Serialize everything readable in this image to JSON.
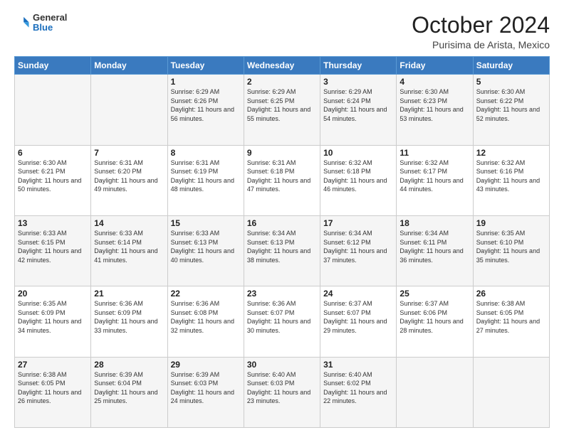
{
  "header": {
    "logo": {
      "general": "General",
      "blue": "Blue"
    },
    "title": "October 2024",
    "location": "Purisima de Arista, Mexico"
  },
  "weekdays": [
    "Sunday",
    "Monday",
    "Tuesday",
    "Wednesday",
    "Thursday",
    "Friday",
    "Saturday"
  ],
  "weeks": [
    [
      {
        "day": "",
        "info": ""
      },
      {
        "day": "",
        "info": ""
      },
      {
        "day": "1",
        "info": "Sunrise: 6:29 AM\nSunset: 6:26 PM\nDaylight: 11 hours and 56 minutes."
      },
      {
        "day": "2",
        "info": "Sunrise: 6:29 AM\nSunset: 6:25 PM\nDaylight: 11 hours and 55 minutes."
      },
      {
        "day": "3",
        "info": "Sunrise: 6:29 AM\nSunset: 6:24 PM\nDaylight: 11 hours and 54 minutes."
      },
      {
        "day": "4",
        "info": "Sunrise: 6:30 AM\nSunset: 6:23 PM\nDaylight: 11 hours and 53 minutes."
      },
      {
        "day": "5",
        "info": "Sunrise: 6:30 AM\nSunset: 6:22 PM\nDaylight: 11 hours and 52 minutes."
      }
    ],
    [
      {
        "day": "6",
        "info": "Sunrise: 6:30 AM\nSunset: 6:21 PM\nDaylight: 11 hours and 50 minutes."
      },
      {
        "day": "7",
        "info": "Sunrise: 6:31 AM\nSunset: 6:20 PM\nDaylight: 11 hours and 49 minutes."
      },
      {
        "day": "8",
        "info": "Sunrise: 6:31 AM\nSunset: 6:19 PM\nDaylight: 11 hours and 48 minutes."
      },
      {
        "day": "9",
        "info": "Sunrise: 6:31 AM\nSunset: 6:18 PM\nDaylight: 11 hours and 47 minutes."
      },
      {
        "day": "10",
        "info": "Sunrise: 6:32 AM\nSunset: 6:18 PM\nDaylight: 11 hours and 46 minutes."
      },
      {
        "day": "11",
        "info": "Sunrise: 6:32 AM\nSunset: 6:17 PM\nDaylight: 11 hours and 44 minutes."
      },
      {
        "day": "12",
        "info": "Sunrise: 6:32 AM\nSunset: 6:16 PM\nDaylight: 11 hours and 43 minutes."
      }
    ],
    [
      {
        "day": "13",
        "info": "Sunrise: 6:33 AM\nSunset: 6:15 PM\nDaylight: 11 hours and 42 minutes."
      },
      {
        "day": "14",
        "info": "Sunrise: 6:33 AM\nSunset: 6:14 PM\nDaylight: 11 hours and 41 minutes."
      },
      {
        "day": "15",
        "info": "Sunrise: 6:33 AM\nSunset: 6:13 PM\nDaylight: 11 hours and 40 minutes."
      },
      {
        "day": "16",
        "info": "Sunrise: 6:34 AM\nSunset: 6:13 PM\nDaylight: 11 hours and 38 minutes."
      },
      {
        "day": "17",
        "info": "Sunrise: 6:34 AM\nSunset: 6:12 PM\nDaylight: 11 hours and 37 minutes."
      },
      {
        "day": "18",
        "info": "Sunrise: 6:34 AM\nSunset: 6:11 PM\nDaylight: 11 hours and 36 minutes."
      },
      {
        "day": "19",
        "info": "Sunrise: 6:35 AM\nSunset: 6:10 PM\nDaylight: 11 hours and 35 minutes."
      }
    ],
    [
      {
        "day": "20",
        "info": "Sunrise: 6:35 AM\nSunset: 6:09 PM\nDaylight: 11 hours and 34 minutes."
      },
      {
        "day": "21",
        "info": "Sunrise: 6:36 AM\nSunset: 6:09 PM\nDaylight: 11 hours and 33 minutes."
      },
      {
        "day": "22",
        "info": "Sunrise: 6:36 AM\nSunset: 6:08 PM\nDaylight: 11 hours and 32 minutes."
      },
      {
        "day": "23",
        "info": "Sunrise: 6:36 AM\nSunset: 6:07 PM\nDaylight: 11 hours and 30 minutes."
      },
      {
        "day": "24",
        "info": "Sunrise: 6:37 AM\nSunset: 6:07 PM\nDaylight: 11 hours and 29 minutes."
      },
      {
        "day": "25",
        "info": "Sunrise: 6:37 AM\nSunset: 6:06 PM\nDaylight: 11 hours and 28 minutes."
      },
      {
        "day": "26",
        "info": "Sunrise: 6:38 AM\nSunset: 6:05 PM\nDaylight: 11 hours and 27 minutes."
      }
    ],
    [
      {
        "day": "27",
        "info": "Sunrise: 6:38 AM\nSunset: 6:05 PM\nDaylight: 11 hours and 26 minutes."
      },
      {
        "day": "28",
        "info": "Sunrise: 6:39 AM\nSunset: 6:04 PM\nDaylight: 11 hours and 25 minutes."
      },
      {
        "day": "29",
        "info": "Sunrise: 6:39 AM\nSunset: 6:03 PM\nDaylight: 11 hours and 24 minutes."
      },
      {
        "day": "30",
        "info": "Sunrise: 6:40 AM\nSunset: 6:03 PM\nDaylight: 11 hours and 23 minutes."
      },
      {
        "day": "31",
        "info": "Sunrise: 6:40 AM\nSunset: 6:02 PM\nDaylight: 11 hours and 22 minutes."
      },
      {
        "day": "",
        "info": ""
      },
      {
        "day": "",
        "info": ""
      }
    ]
  ]
}
